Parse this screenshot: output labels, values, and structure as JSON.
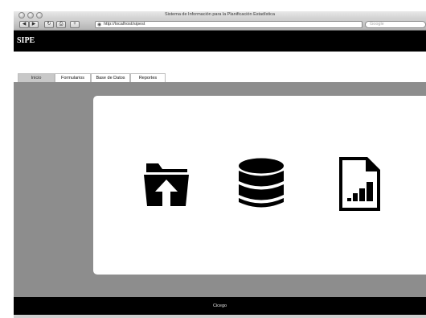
{
  "browser": {
    "window_title": "Sistema de Información para la Planificación Estadística",
    "url": "http://localhost/sipest",
    "search_placeholder": "Google",
    "buttons": {
      "back": "◀",
      "forward": "▶",
      "reload": "↻",
      "print": "⎙",
      "add": "+"
    }
  },
  "app": {
    "logo": "SIPE"
  },
  "tabs": [
    {
      "label": "Inicio",
      "active": true
    },
    {
      "label": "Formularios",
      "active": false
    },
    {
      "label": "Base de Datos",
      "active": false
    },
    {
      "label": "Reportes",
      "active": false
    }
  ],
  "main": {
    "icons": [
      "folder-upload-icon",
      "database-icon",
      "report-document-icon"
    ]
  },
  "footer": {
    "text": "Cicego"
  },
  "colors": {
    "header": "#000000",
    "content_background": "#8d8d8d",
    "card": "#ffffff",
    "active_tab": "#c8c8c8"
  }
}
